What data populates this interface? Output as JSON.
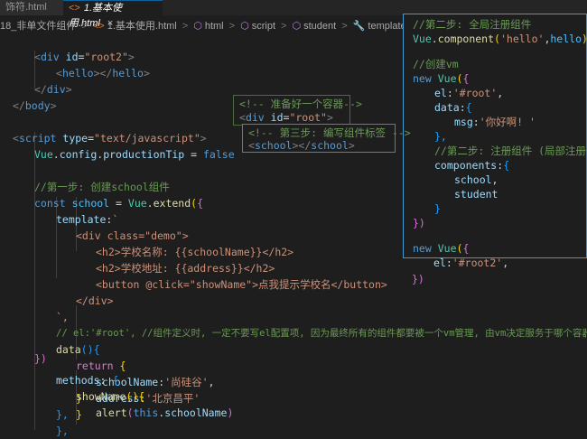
{
  "tabs": [
    {
      "label": "饰符.html"
    },
    {
      "label": "1.基本使用.html",
      "close": "×"
    }
  ],
  "breadcrumb": {
    "items": [
      "18_非单文件组件",
      "1.基本使用.html",
      "html",
      "script",
      "student",
      "template"
    ],
    "sep": ">"
  },
  "editor": {
    "l1": [
      "<",
      "div",
      " id",
      "=",
      "\"root2\"",
      ">"
    ],
    "l2": [
      "<",
      "hello",
      "></",
      "hello",
      ">"
    ],
    "l3": [
      "</",
      "div",
      ">"
    ],
    "l4": [
      "</",
      "body",
      ">"
    ],
    "l6": [
      "<",
      "script",
      " type",
      "=",
      "\"text/javascript\"",
      ">"
    ],
    "l7": [
      "Vue",
      ".",
      "config",
      ".",
      "productionTip",
      " = ",
      "false"
    ],
    "l9": "//第一步: 创建school组件",
    "l10": [
      "const",
      " ",
      "school",
      " = ",
      "Vue",
      ".",
      "extend",
      "(",
      "{"
    ],
    "l11": [
      "template",
      ":",
      "`"
    ],
    "l12": "<div class=\"demo\">",
    "l13": "<h2>学校名称: {{schoolName}}</h2>",
    "l14": "<h2>学校地址: {{address}}</h2>",
    "l15": "<button @click=\"showName\">点我提示学校名</button>",
    "l16": "</div>",
    "l17": "`,",
    "l18": "// el:'#root', //组件定义时, 一定不要写el配置项, 因为最终所有的组件都要被一个vm管理, 由vm决定服务于哪个容器。",
    "l19": [
      "data",
      "()",
      "{"
    ],
    "l20": [
      "return",
      " ",
      "{"
    ],
    "l21": [
      "schoolName",
      ":",
      "'尚硅谷'",
      ","
    ],
    "l22": [
      "address",
      ":",
      "'北京昌平'"
    ],
    "l23": "}",
    "l24": "},",
    "l25": [
      "methods",
      ": ",
      "{"
    ],
    "l26": [
      "showName",
      "()",
      "{"
    ],
    "l27": [
      "alert",
      "(",
      "this",
      ".",
      "schoolName",
      ")"
    ],
    "l28": "}",
    "l29": "},",
    "l30": "})"
  },
  "overlay_right": {
    "r1": "//第二步: 全局注册组件",
    "r2": [
      "Vue",
      ".",
      "component",
      "(",
      "'hello'",
      ",",
      "hello",
      ")"
    ],
    "r4": "//创建vm",
    "r5": [
      "new",
      " ",
      "Vue",
      "(",
      "{"
    ],
    "r6": [
      "el",
      ":",
      "'#root'",
      ","
    ],
    "r7": [
      "data",
      ":",
      "{"
    ],
    "r8": [
      "msg",
      ":",
      "'你好啊! '"
    ],
    "r9": "},",
    "r10": "//第二步: 注册组件 (局部注册)",
    "r11": [
      "components",
      ":",
      "{"
    ],
    "r12": [
      "school",
      ","
    ],
    "r13": "student",
    "r14": "}",
    "r15": "})",
    "r17": [
      "new",
      " ",
      "Vue",
      "(",
      "{"
    ],
    "r18": [
      "el",
      ":",
      "'#root2'",
      ","
    ],
    "r19": "})"
  },
  "overlay_mid1": {
    "m1": "<!-- 准备好一个容器-->",
    "m2": [
      "<",
      "div",
      " id",
      "=",
      "\"root\"",
      ">"
    ]
  },
  "overlay_mid2": {
    "m3": "<!-- 第三步: 编写组件标签 -->",
    "m4": [
      "<",
      "school",
      "></",
      "school",
      ">"
    ]
  }
}
